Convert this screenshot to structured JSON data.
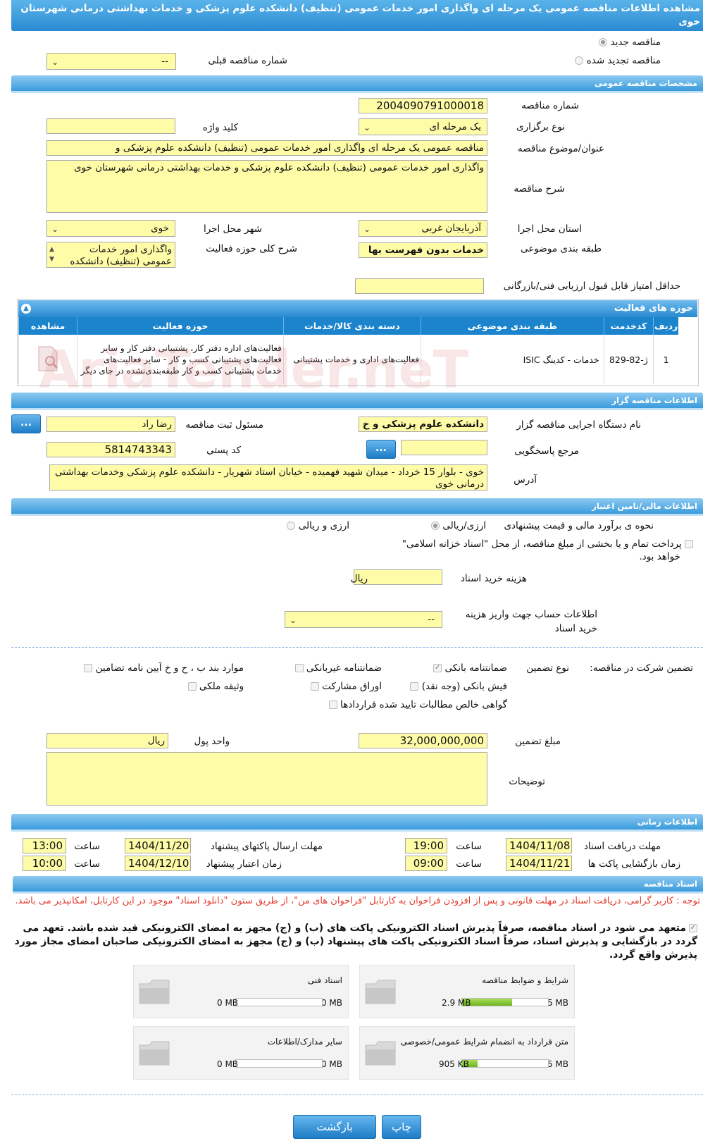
{
  "header": {
    "title": "مشاهده اطلاعات مناقصه عمومی یک مرحله ای واگذاری امور خدمات عمومی (تنظیف) دانشکده علوم پزشکی و خدمات بهداشتی درمانی شهرستان خوی"
  },
  "top": {
    "radio_new": "مناقصه جدید",
    "radio_renewed": "مناقصه تجدید شده",
    "prev_number_label": "شماره مناقصه قبلی",
    "prev_number_value": "--"
  },
  "general": {
    "section_title": "مشخصات مناقصه عمومی",
    "number_label": "شماره مناقصه",
    "number_value": "2004090791000018",
    "type_label": "نوع برگزاری",
    "type_value": "یک مرحله ای",
    "keyword_label": "کلید واژه",
    "keyword_value": "",
    "subject_label": "عنوان/موضوع مناقصه",
    "subject_value": "مناقصه عمومی یک مرحله ای واگذاری امور خدمات عمومی (تنظیف)  دانشکده علوم پزشکی و",
    "desc_label": "شرح مناقصه",
    "desc_value": "واگذاری امور خدمات عمومی (تنظیف)  دانشکده علوم پزشکی و خدمات بهداشتی درمانی شهرستان خوی",
    "province_label": "استان محل اجرا",
    "province_value": "آذربایجان غربی",
    "city_label": "شهر محل اجرا",
    "city_value": "خوی",
    "category_label": "طبقه بندی موضوعی",
    "category_value": "خدمات بدون فهرست بها",
    "scope_label": "شرح کلی حوزه فعالیت",
    "scope_value": "واگذاری امور خدمات عمومی (تنظیف)  دانشکده",
    "min_score_label": "حداقل امتیاز قابل قبول ارزیابی فنی/بازرگانی",
    "min_score_value": ""
  },
  "activities": {
    "title": "حوزه های فعالیت",
    "headers": [
      "ردیف",
      "کدخدمت",
      "طبقه بندی موضوعی",
      "دسته بندی کالا/خدمات",
      "حوزه فعالیت",
      "مشاهده"
    ],
    "rows": [
      {
        "row": "1",
        "code": "ژ-82-829",
        "category": "خدمات - کدینگ ISIC",
        "group": "فعالیت‌های اداری و خدمات پشتیبانی",
        "scope": "فعالیت‌های  اداره دفتر کار، پشتیبانی دفتر کار و سایر  فعالیت‌های پشتیبانی کسب و کار - سایر فعالیت‌های خدمات پشتیبانی کسب و کار طبقه‌بندی‌نشده در جای دیگر"
      }
    ]
  },
  "organizer": {
    "section_title": "اطلاعات مناقصه گزار",
    "org_label": "نام دستگاه اجرایی مناقصه گزار",
    "org_value": "دانشکده علوم پزشکی و خ",
    "registrar_label": "مسئول ثبت مناقصه",
    "registrar_value": "رضا راد",
    "ref_label": "مرجع پاسخگویی",
    "ref_value": "",
    "postal_label": "کد پستی",
    "postal_value": "5814743343",
    "address_label": "آدرس",
    "address_value": "خوی - بلوار 15 خرداد - میدان شهید فهمیده - خیابان استاد شهریار - دانشکده علوم پزشکی وخدمات بهداشتی درمانی خوی",
    "dots_label": "..."
  },
  "finance": {
    "section_title": "اطلاعات مالی/تامین اعتبار",
    "estimate_label": "نحوه ی برآورد مالی و قیمت پیشنهادی",
    "opt_currency": "ارزی/ریالی",
    "opt_currency_rial": "ارزی و ریالی",
    "treasury_text": "پرداخت تمام و یا بخشی از مبلغ مناقصه، از محل \"اسناد خزانه اسلامی\"",
    "treasury_text2": "خواهد بود.",
    "doc_cost_label": "هزینه خرید اسناد",
    "doc_cost_value": "",
    "doc_cost_unit": "ریال",
    "account_label": "اطلاعات حساب جهت واریز هزینه خرید اسناد",
    "account_value": "--"
  },
  "guarantee": {
    "participation_label": "تضمین شرکت در مناقصه:",
    "type_label": "نوع تضمین",
    "bank_guarantee": "ضمانتنامه بانکی",
    "nonbank_guarantee": "ضمانتنامه غیربانکی",
    "clauses": "موارد بند ب ، ح و خ آیین نامه تضامین",
    "bank_receipt": "فیش بانکی (وجه نقد)",
    "bonds": "اوراق مشارکت",
    "property": "وثیقه ملکی",
    "receivables": "گواهی خالص مطالبات تایید شده قراردادها",
    "amount_label": "مبلغ تضمین",
    "amount_value": "32,000,000,000",
    "currency_label": "واحد پول",
    "currency_value": "ریال",
    "notes_label": "توضیحات",
    "notes_value": ""
  },
  "timing": {
    "section_title": "اطلاعات زمانی",
    "doc_deadline_label": "مهلت دریافت اسناد",
    "doc_deadline_date": "1404/11/08",
    "doc_deadline_time": "19:00",
    "send_deadline_label": "مهلت ارسال پاکتهای پیشنهاد",
    "send_deadline_date": "1404/11/20",
    "send_deadline_time": "13:00",
    "open_label": "زمان بازگشایی پاکت ها",
    "open_date": "1404/11/21",
    "open_time": "09:00",
    "validity_label": "زمان اعتبار پیشنهاد",
    "validity_date": "1404/12/10",
    "validity_time": "10:00",
    "time_label": "ساعت"
  },
  "documents": {
    "section_title": "اسناد مناقصه",
    "notice": "توجه : کاربر گرامی، دریافت اسناد در مهلت قانونی و پس از افزودن فراخوان به کارتابل \"فراخوان های من\"، از طریق ستون \"دانلود اسناد\" موجود در این کارتابل، امکانپذیر می باشد.",
    "commitment": "متعهد می شود در اسناد مناقصه، صرفاً پذیرش اسناد الکترونیکی پاکت های (ب) و (ج) مجهز به امضای الکترونیکی قید شده باشد. تعهد می گردد در بازگشایی و پذیرش اسناد، صرفاً اسناد الکترونیکی پاکت های پیشنهاد (ب) و (ج) مجهز به امضای الکترونیکی صاحبان امضای مجاز مورد پذیرش واقع گردد.",
    "files": [
      {
        "name": "شرایط و ضوابط مناقصه",
        "size": "2.9 MB",
        "max": "5 MB",
        "fill": 0.58
      },
      {
        "name": "اسناد فنی",
        "size": "0 MB",
        "max": "50 MB",
        "fill": 0
      },
      {
        "name": "متن قرارداد به انضمام شرایط عمومی/خصوصی",
        "size": "905 KB",
        "max": "5 MB",
        "fill": 0.18
      },
      {
        "name": "سایر مدارک/اطلاعات",
        "size": "0 MB",
        "max": "50 MB",
        "fill": 0
      }
    ]
  },
  "footer": {
    "back_label": "بازگشت",
    "print_label": "چاپ"
  },
  "watermark": "AriaTender.neT"
}
